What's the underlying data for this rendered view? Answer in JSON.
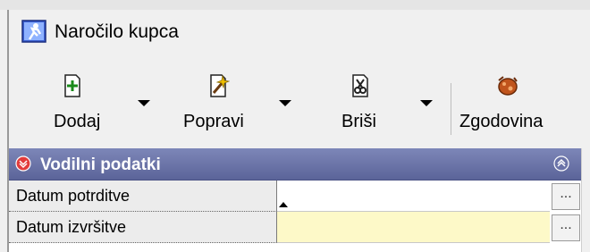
{
  "window": {
    "title": "Naročilo kupca"
  },
  "toolbar": {
    "buttons": [
      {
        "label": "Dodaj",
        "icon": "add-document-icon",
        "has_dropdown": true
      },
      {
        "label": "Popravi",
        "icon": "edit-wand-icon",
        "has_dropdown": true
      },
      {
        "label": "Briši",
        "icon": "delete-document-icon",
        "has_dropdown": true
      },
      {
        "label": "Zgodovina",
        "icon": "history-icon",
        "has_dropdown": false
      }
    ]
  },
  "section": {
    "title": "Vodilni podatki",
    "expand_icon": "chevron-circle-down-icon",
    "collapse_icon": "chevron-circle-up-icon"
  },
  "fields": [
    {
      "label": "Datum potrditve",
      "value": "",
      "button": "...",
      "mandatory": false
    },
    {
      "label": "Datum izvršitve",
      "value": "",
      "button": "...",
      "mandatory": true
    }
  ],
  "colors": {
    "header_bg": "#6a73a8",
    "mandatory_bg": "#fdf9c8",
    "window_bg": "#f0f0f0"
  }
}
